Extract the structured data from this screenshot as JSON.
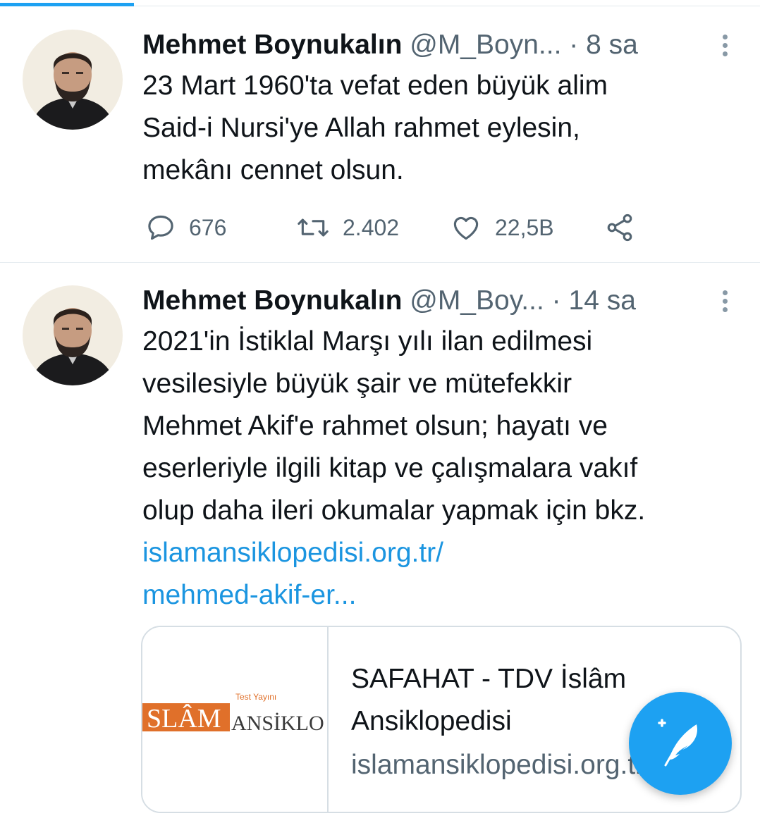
{
  "accent_color": "#1da1f2",
  "link_color": "#1b95e0",
  "tweets": [
    {
      "author_name": "Mehmet Boynukalın",
      "handle": "@M_Boyn...",
      "separator": "·",
      "time": "8 sa",
      "text_lines": [
        "23 Mart 1960'ta vefat eden büyük alim",
        "Said-i Nursi'ye Allah rahmet eylesin,",
        "mekânı cennet olsun."
      ],
      "replies": "676",
      "retweets": "2.402",
      "likes": "22,5B"
    },
    {
      "author_name": "Mehmet Boynukalın",
      "handle": "@M_Boy...",
      "separator": "·",
      "time": "14 sa",
      "text_lines": [
        "2021'in İstiklal Marşı yılı ilan edilmesi",
        "vesilesiyle büyük şair ve mütefekkir",
        "Mehmet Akif'e rahmet olsun; hayatı ve",
        "eserleriyle ilgili kitap ve çalışmalara vakıf",
        "olup daha ileri okumalar yapmak için bkz."
      ],
      "link_lines": [
        "islamansiklopedisi.org.tr/",
        "mehmed-akif-er..."
      ],
      "card": {
        "thumb_logo_main": "SLÂM",
        "thumb_logo_sub": "ANSİKLO",
        "thumb_logo_tag": "Test Yayını",
        "title_line1": "SAFAHAT - TDV İslâm",
        "title_line2": "Ansiklopedisi",
        "domain": "islamansiklopedisi.org.tr"
      }
    }
  ],
  "icons": {
    "reply": "reply-icon",
    "retweet": "retweet-icon",
    "like": "heart-icon",
    "share": "share-icon",
    "more": "more-vertical-icon",
    "compose": "compose-tweet-icon"
  }
}
